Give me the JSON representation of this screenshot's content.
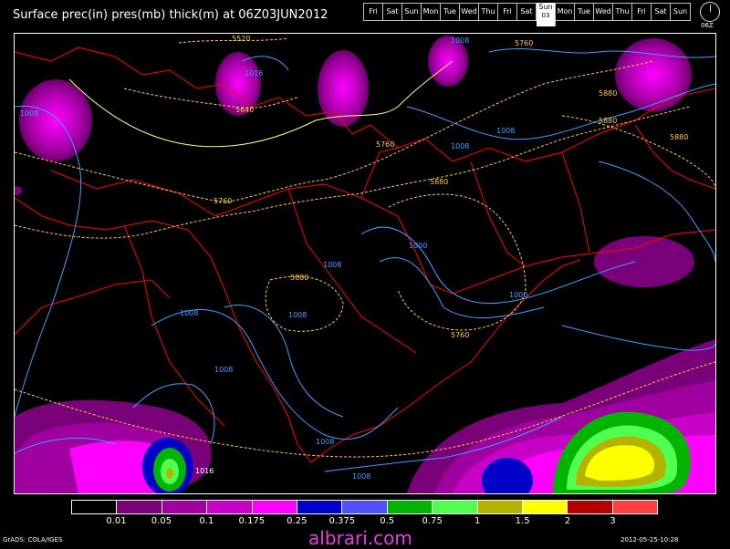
{
  "title": "Surface prec(in) pres(mb) thick(m) at 06Z03JUN2012",
  "days": [
    {
      "label": "Fri"
    },
    {
      "label": "Sat"
    },
    {
      "label": "Sun"
    },
    {
      "label": "Mon"
    },
    {
      "label": "Tue"
    },
    {
      "label": "Wed"
    },
    {
      "label": "Thu"
    },
    {
      "label": "Fri"
    },
    {
      "label": "Sat"
    },
    {
      "label": "Sun",
      "date": "03",
      "active": true
    },
    {
      "label": "Mon"
    },
    {
      "label": "Tue"
    },
    {
      "label": "Wed"
    },
    {
      "label": "Thu"
    },
    {
      "label": "Fri"
    },
    {
      "label": "Sat"
    },
    {
      "label": "Sun"
    }
  ],
  "globe_label": "06Z",
  "contour_labels": {
    "thickness": [
      "5520",
      "5640",
      "5760",
      "5760",
      "5760",
      "5880",
      "5880",
      "5880",
      "5880",
      "5760",
      "5880"
    ],
    "pressure": [
      "1008",
      "1016",
      "1008",
      "1008",
      "1008",
      "1000",
      "1000",
      "1008",
      "1008",
      "1008",
      "1008",
      "1016",
      "1008",
      "1008"
    ]
  },
  "legend": {
    "colors": [
      "#000000",
      "#7a007a",
      "#a000a0",
      "#c800c8",
      "#ff00ff",
      "#0000c8",
      "#5050ff",
      "#00b400",
      "#50ff50",
      "#b4b400",
      "#ffff00",
      "#b40000",
      "#ff4040"
    ],
    "ticks": [
      "0.01",
      "0.05",
      "0.1",
      "0.175",
      "0.25",
      "0.375",
      "0.5",
      "0.75",
      "1",
      "1.5",
      "2",
      "3"
    ]
  },
  "footer": {
    "left": "GrADS: COLA/IGES",
    "watermark": "albrari.com",
    "right": "2012-05-25-10:28"
  },
  "colors": {
    "coast": "#ff0000",
    "pressure": "#3ca0ff",
    "thickness": "#ffcc33",
    "thickness_bold": "#ffff66"
  }
}
